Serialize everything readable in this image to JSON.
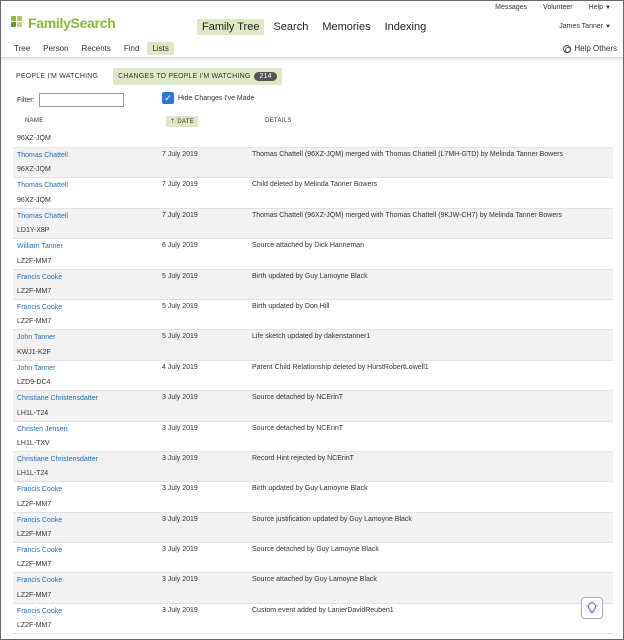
{
  "util": {
    "messages": "Messages",
    "volunteer": "Volunteer",
    "help": "Help"
  },
  "logo_text": "FamilySearch",
  "main_nav": [
    {
      "label": "Family Tree"
    },
    {
      "label": "Search"
    },
    {
      "label": "Memories"
    },
    {
      "label": "Indexing"
    }
  ],
  "user_name": "James Tanner",
  "sub_nav": [
    {
      "label": "Tree"
    },
    {
      "label": "Person"
    },
    {
      "label": "Recents"
    },
    {
      "label": "Find"
    },
    {
      "label": "Lists"
    }
  ],
  "help_others": "Help Others",
  "tabs": {
    "watching": "PEOPLE I'M WATCHING",
    "changes": "CHANGES TO PEOPLE I'M WATCHING",
    "count": "214"
  },
  "filter": {
    "label": "Filter:",
    "value": ""
  },
  "hide_changes": "Hide Changes I've Made",
  "columns": {
    "name": "NAME",
    "date": "DATE",
    "details": "DETAILS"
  },
  "first_id": "96XZ-JQM",
  "rows": [
    {
      "name": "Thomas Chattell",
      "id": "96XZ-JQM",
      "date": "7 July 2019",
      "details": "Thomas Chattell (96XZ-JQM) merged with Thomas Chattell (L7MH-GTD) by Melinda Tanner Bowers"
    },
    {
      "name": "Thomas Chattell",
      "id": "96XZ-JQM",
      "date": "7 July 2019",
      "details": "Child deleted by Melinda Tanner Bowers"
    },
    {
      "name": "Thomas Chattell",
      "id": "LD1Y-X8P",
      "date": "7 July 2019",
      "details": "Thomas Chattell (96XZ-JQM) merged with Thomas Chattell (9KJW-CH7) by Melinda Tanner Bowers"
    },
    {
      "name": "William Tanner",
      "id": "LZ2F-MM7",
      "date": "6 July 2019",
      "details": "Source attached by Dick Hanneman"
    },
    {
      "name": "Francis Cooke",
      "id": "LZ2F-MM7",
      "date": "5 July 2019",
      "details": "Birth updated by Guy Lamoyne Black"
    },
    {
      "name": "Francis Cooke",
      "id": "LZ2F-MM7",
      "date": "5 July 2019",
      "details": "Birth updated by Don Hill"
    },
    {
      "name": "John Tanner",
      "id": "KWJ1-K2F",
      "date": "5 July 2019",
      "details": "Life sketch updated by dakenstanner1"
    },
    {
      "name": "John Tanner",
      "id": "LZD9-DC4",
      "date": "4 July 2019",
      "details": "Parent Child Relationship deleted by HurstRobertLowell1"
    },
    {
      "name": "Christiane Christensdatter",
      "id": "LH1L-T24",
      "date": "3 July 2019",
      "details": "Source detached by NCErinT"
    },
    {
      "name": "Christen Jensen",
      "id": "LH1L-TXV",
      "date": "3 July 2019",
      "details": "Source detached by NCErinT"
    },
    {
      "name": "Christiane Christensdatter",
      "id": "LH1L-T24",
      "date": "3 July 2019",
      "details": "Record Hint rejected by NCErinT"
    },
    {
      "name": "Francis Cooke",
      "id": "LZ2F-MM7",
      "date": "3 July 2019",
      "details": "Birth updated by Guy Lamoyne Black"
    },
    {
      "name": "Francis Cooke",
      "id": "LZ2F-MM7",
      "date": "3 July 2019",
      "details": "Source justification updated by Guy Lamoyne Black"
    },
    {
      "name": "Francis Cooke",
      "id": "LZ2F-MM7",
      "date": "3 July 2019",
      "details": "Source detached by Guy Lamoyne Black"
    },
    {
      "name": "Francis Cooke",
      "id": "LZ2F-MM7",
      "date": "3 July 2019",
      "details": "Source attached by Guy Lamoyne Black"
    },
    {
      "name": "Francis Cooke",
      "id": "LZ2F-MM7",
      "date": "3 July 2019",
      "details": "Custom event added by LanierDavidReuben1"
    }
  ],
  "colors": {
    "accent": "#8cb83d",
    "highlight": "#dfe8c4",
    "link": "#1f6fb8",
    "checkbox": "#2b79d8"
  }
}
